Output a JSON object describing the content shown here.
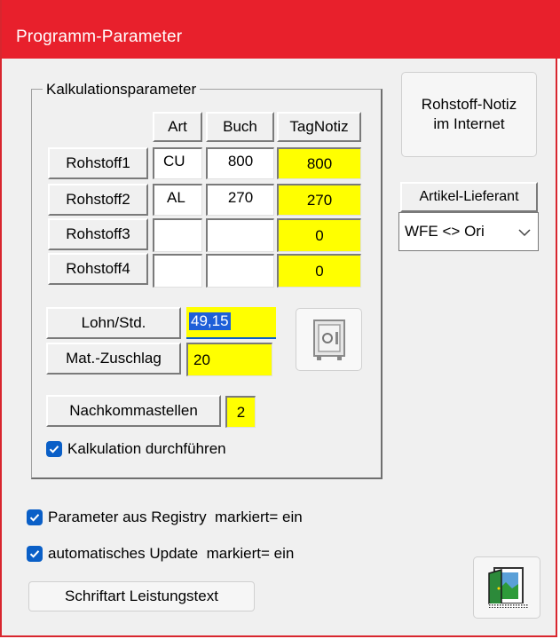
{
  "window": {
    "title": "Programm-Parameter"
  },
  "group": {
    "legend": "Kalkulationsparameter",
    "columns": [
      "Art",
      "Buch",
      "TagNotiz"
    ],
    "rows": [
      {
        "label": "Rohstoff1",
        "art": "CU",
        "buch": "800",
        "tagnotiz": "800"
      },
      {
        "label": "Rohstoff2",
        "art": "AL",
        "buch": "270",
        "tagnotiz": "270"
      },
      {
        "label": "Rohstoff3",
        "art": "",
        "buch": "",
        "tagnotiz": "0"
      },
      {
        "label": "Rohstoff4",
        "art": "",
        "buch": "",
        "tagnotiz": "0"
      }
    ],
    "lohn_label": "Lohn/Std.",
    "lohn_value": "49,15",
    "mat_label": "Mat.-Zuschlag",
    "mat_value": "20",
    "nachkomma_label": "Nachkommastellen",
    "nachkomma_value": "2",
    "kalkulation_label": "Kalkulation durchführen",
    "kalkulation_checked": true
  },
  "rohstoff_button": {
    "line1": "Rohstoff-Notiz",
    "line2": "im Internet"
  },
  "artikel_label": "Artikel-Lieferant",
  "artikel_select": "WFE <> Ori",
  "options": {
    "registry_label": "Parameter aus Registry  markiert= ein",
    "update_label": "automatisches Update  markiert= ein"
  },
  "font_button": "Schriftart Leistungstext",
  "icons": {
    "safe": "safe-icon",
    "exit": "exit-door-icon",
    "check": "checkmark-icon",
    "chevron": "chevron-down-icon"
  },
  "colors": {
    "title_bar": "#e8202c",
    "highlight": "#ffff00",
    "check": "#0a5fc7"
  }
}
